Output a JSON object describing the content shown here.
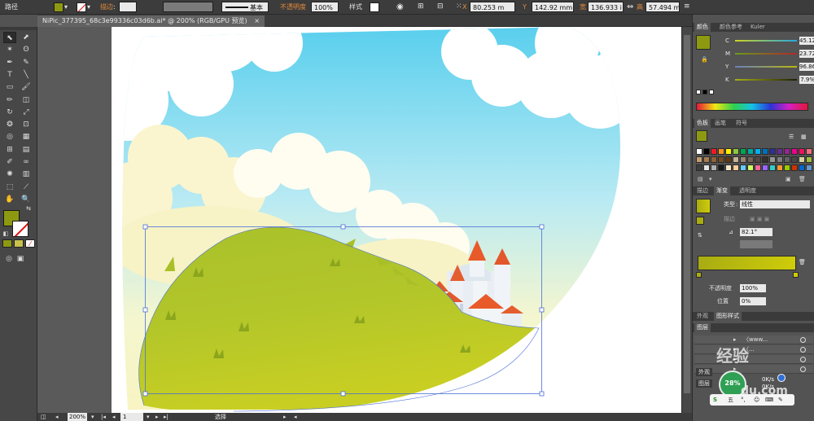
{
  "control_bar": {
    "object_type": "路径",
    "fill_color": "#8d9a11",
    "stroke_label": "描边",
    "stroke_style": "基本",
    "opacity_label": "不透明度",
    "opacity_value": "100%",
    "style_label": "样式",
    "x_label": "X",
    "x_value": "80.253 m",
    "y_label": "Y",
    "y_value": "142.92 mm",
    "w_label": "宽",
    "w_value": "136.933 i",
    "h_label": "高",
    "h_value": "57.494 mm"
  },
  "document": {
    "tab_title": "NiPic_377395_68c3e99336c03d6b.ai* @ 200% (RGB/GPU 预览)",
    "close_glyph": "×"
  },
  "status_bar": {
    "zoom": "200%",
    "artboard_number": "1",
    "tool_status": "选择"
  },
  "toolbox": {
    "tools": [
      {
        "name": "selection-tool",
        "glyph": "⬉"
      },
      {
        "name": "direct-selection-tool",
        "glyph": "⬈"
      },
      {
        "name": "magic-wand-tool",
        "glyph": "✶"
      },
      {
        "name": "lasso-tool",
        "glyph": "ʘ"
      },
      {
        "name": "pen-tool",
        "glyph": "✒"
      },
      {
        "name": "curvature-tool",
        "glyph": "✎"
      },
      {
        "name": "type-tool",
        "glyph": "T"
      },
      {
        "name": "line-tool",
        "glyph": "╲"
      },
      {
        "name": "rectangle-tool",
        "glyph": "▭"
      },
      {
        "name": "paintbrush-tool",
        "glyph": "🖌"
      },
      {
        "name": "pencil-tool",
        "glyph": "✏"
      },
      {
        "name": "eraser-tool",
        "glyph": "◫"
      },
      {
        "name": "rotate-tool",
        "glyph": "↻"
      },
      {
        "name": "scale-tool",
        "glyph": "⤢"
      },
      {
        "name": "warp-tool",
        "glyph": "❂"
      },
      {
        "name": "free-transform-tool",
        "glyph": "⊡"
      },
      {
        "name": "shape-builder-tool",
        "glyph": "◎"
      },
      {
        "name": "perspective-grid-tool",
        "glyph": "▦"
      },
      {
        "name": "mesh-tool",
        "glyph": "⊞"
      },
      {
        "name": "gradient-tool",
        "glyph": "▤"
      },
      {
        "name": "eyedropper-tool",
        "glyph": "✐"
      },
      {
        "name": "blend-tool",
        "glyph": "∞"
      },
      {
        "name": "symbol-sprayer-tool",
        "glyph": "✺"
      },
      {
        "name": "column-graph-tool",
        "glyph": "▥"
      },
      {
        "name": "artboard-tool",
        "glyph": "⬚"
      },
      {
        "name": "slice-tool",
        "glyph": "⟋"
      },
      {
        "name": "hand-tool",
        "glyph": "✋"
      },
      {
        "name": "zoom-tool",
        "glyph": "🔍"
      }
    ]
  },
  "color_panel": {
    "tabs": [
      "颜色",
      "颜色参考",
      "Kuler"
    ],
    "channels": [
      {
        "letter": "C",
        "value": "45.12%"
      },
      {
        "letter": "M",
        "value": "23.72%"
      },
      {
        "letter": "Y",
        "value": "96.86%"
      },
      {
        "letter": "K",
        "value": "7.9%"
      }
    ]
  },
  "swatches_panel": {
    "tabs": [
      "色板",
      "画笔",
      "符号"
    ]
  },
  "gradient_panel": {
    "tabs": [
      "描边",
      "渐变",
      "透明度"
    ],
    "type_label": "类型",
    "type_value": "线性",
    "stroke_label": "描边",
    "angle_value": "82.1°",
    "opacity_label": "不透明度",
    "opacity_value": "100%",
    "location_label": "位置",
    "location_value": "0%",
    "start_color": "#a8ac12",
    "end_color": "#cfcc0a"
  },
  "appearance_panel": {
    "tabs": [
      "外观",
      "图形样式"
    ]
  },
  "layers_panel": {
    "title": "图层",
    "rows": [
      "〈www...",
      "〈...",
      "",
      ""
    ],
    "bottom_tab_1": "外观",
    "bottom_tab_2": "图层"
  },
  "watermark": {
    "percent": "28%",
    "rate1": "0K/s",
    "rate2": "0K/s",
    "site_chars": "经验",
    "site_url": "du.com"
  }
}
